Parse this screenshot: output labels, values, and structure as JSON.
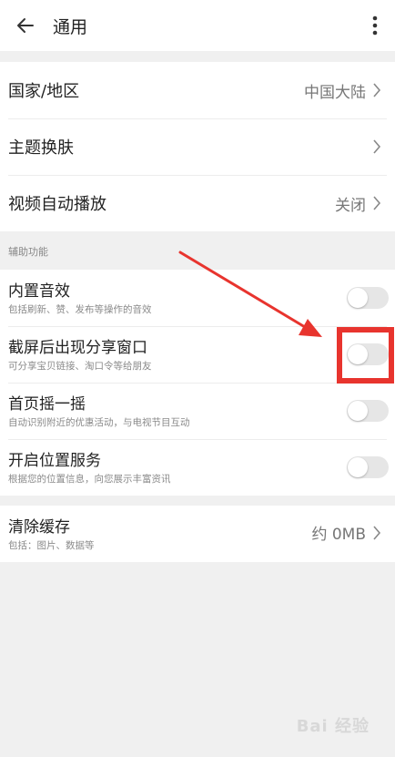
{
  "header": {
    "title": "通用"
  },
  "general": {
    "items": [
      {
        "label": "国家/地区",
        "value": "中国大陆"
      },
      {
        "label": "主题换肤",
        "value": ""
      },
      {
        "label": "视频自动播放",
        "value": "关闭"
      }
    ]
  },
  "assist": {
    "section_label": "辅助功能",
    "items": [
      {
        "label": "内置音效",
        "sub": "包括刷新、赞、发布等操作的音效",
        "on": false
      },
      {
        "label": "截屏后出现分享窗口",
        "sub": "可分享宝贝链接、淘口令等给朋友",
        "on": false
      },
      {
        "label": "首页摇一摇",
        "sub": "自动识别附近的优惠活动，与电视节目互动",
        "on": false
      },
      {
        "label": "开启位置服务",
        "sub": "根据您的位置信息，向您展示丰富资讯",
        "on": false
      }
    ]
  },
  "cache": {
    "label": "清除缓存",
    "sub": "包括：图片、数据等",
    "value": "约 0MB"
  },
  "annotation": {
    "color": "#e8342e"
  },
  "watermark": {
    "text": "Bai 经验"
  },
  "colors": {
    "background": "#f0f0f0",
    "toggle_off": "#e6e6e6",
    "annotation_red": "#e8342e"
  }
}
